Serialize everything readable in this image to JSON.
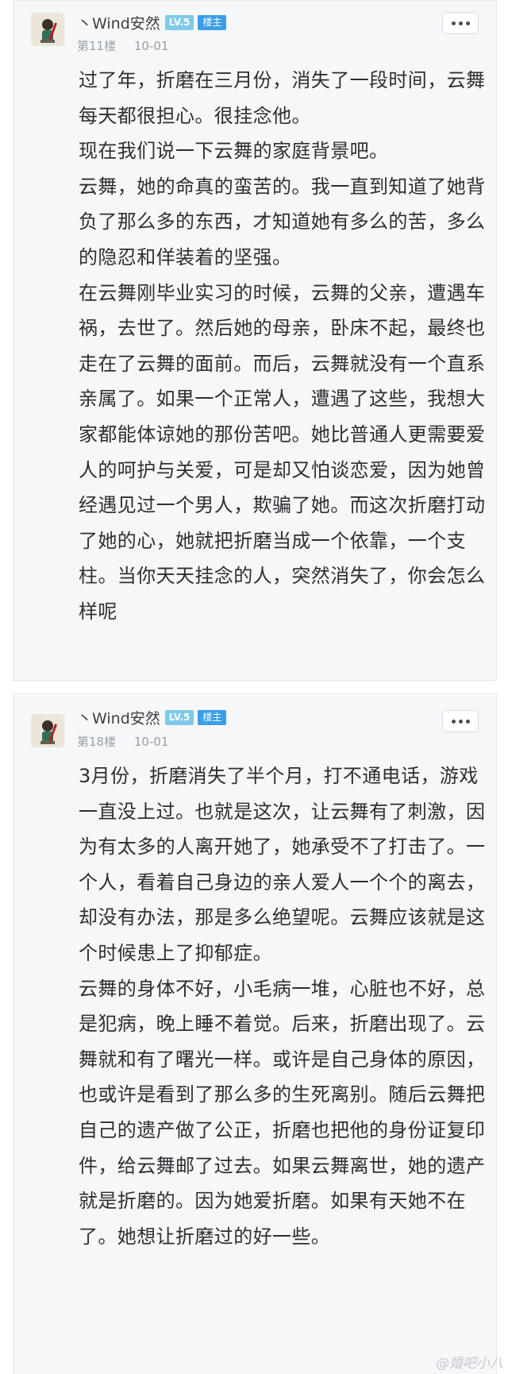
{
  "posts": [
    {
      "username": "丶Wind安然",
      "level": "LV.5",
      "role_badge": "楼主",
      "floor": "第11楼",
      "date": "10-01",
      "paragraphs": [
        "过了年，折磨在三月份，消失了一段时间，云舞每天都很担心。很挂念他。",
        "现在我们说一下云舞的家庭背景吧。",
        "云舞，她的命真的蛮苦的。我一直到知道了她背负了那么多的东西，才知道她有多么的苦，多么的隐忍和佯装着的坚强。",
        "在云舞刚毕业实习的时候，云舞的父亲，遭遇车祸，去世了。然后她的母亲，卧床不起，最终也走在了云舞的面前。而后，云舞就没有一个直系亲属了。如果一个正常人，遭遇了这些，我想大家都能体谅她的那份苦吧。她比普通人更需要爱人的呵护与关爱，可是却又怕谈恋爱，因为她曾经遇见过一个男人，欺骗了她。而这次折磨打动了她的心，她就把折磨当成一个依靠，一个支柱。当你天天挂念的人，突然消失了，你会怎么样呢"
      ]
    },
    {
      "username": "丶Wind安然",
      "level": "LV.5",
      "role_badge": "楼主",
      "floor": "第18楼",
      "date": "10-01",
      "paragraphs": [
        "3月份，折磨消失了半个月，打不通电话，游戏一直没上过。也就是这次，让云舞有了刺激，因为有太多的人离开她了，她承受不了打击了。一个人，看着自己身边的亲人爱人一个个的离去，却没有办法，那是多么绝望呢。云舞应该就是这个时候患上了抑郁症。",
        "云舞的身体不好，小毛病一堆，心脏也不好，总是犯病，晚上睡不着觉。后来，折磨出现了。云舞就和有了曙光一样。或许是自己身体的原因，也或许是看到了那么多的生死离别。随后云舞把自己的遗产做了公正，折磨也把他的身份证复印件，给云舞邮了过去。如果云舞离世，她的遗产就是折磨的。因为她爱折磨。如果有天她不在了。她想让折磨过的好一些。"
      ]
    }
  ],
  "watermark": "@婚吧小八",
  "colors": {
    "level_badge": "#7fcae8",
    "role_badge": "#3a9ee8",
    "card_bg": "#f6f7f8"
  },
  "icons": {
    "avatar": "avatar-icon",
    "more": "more-dots-icon"
  }
}
